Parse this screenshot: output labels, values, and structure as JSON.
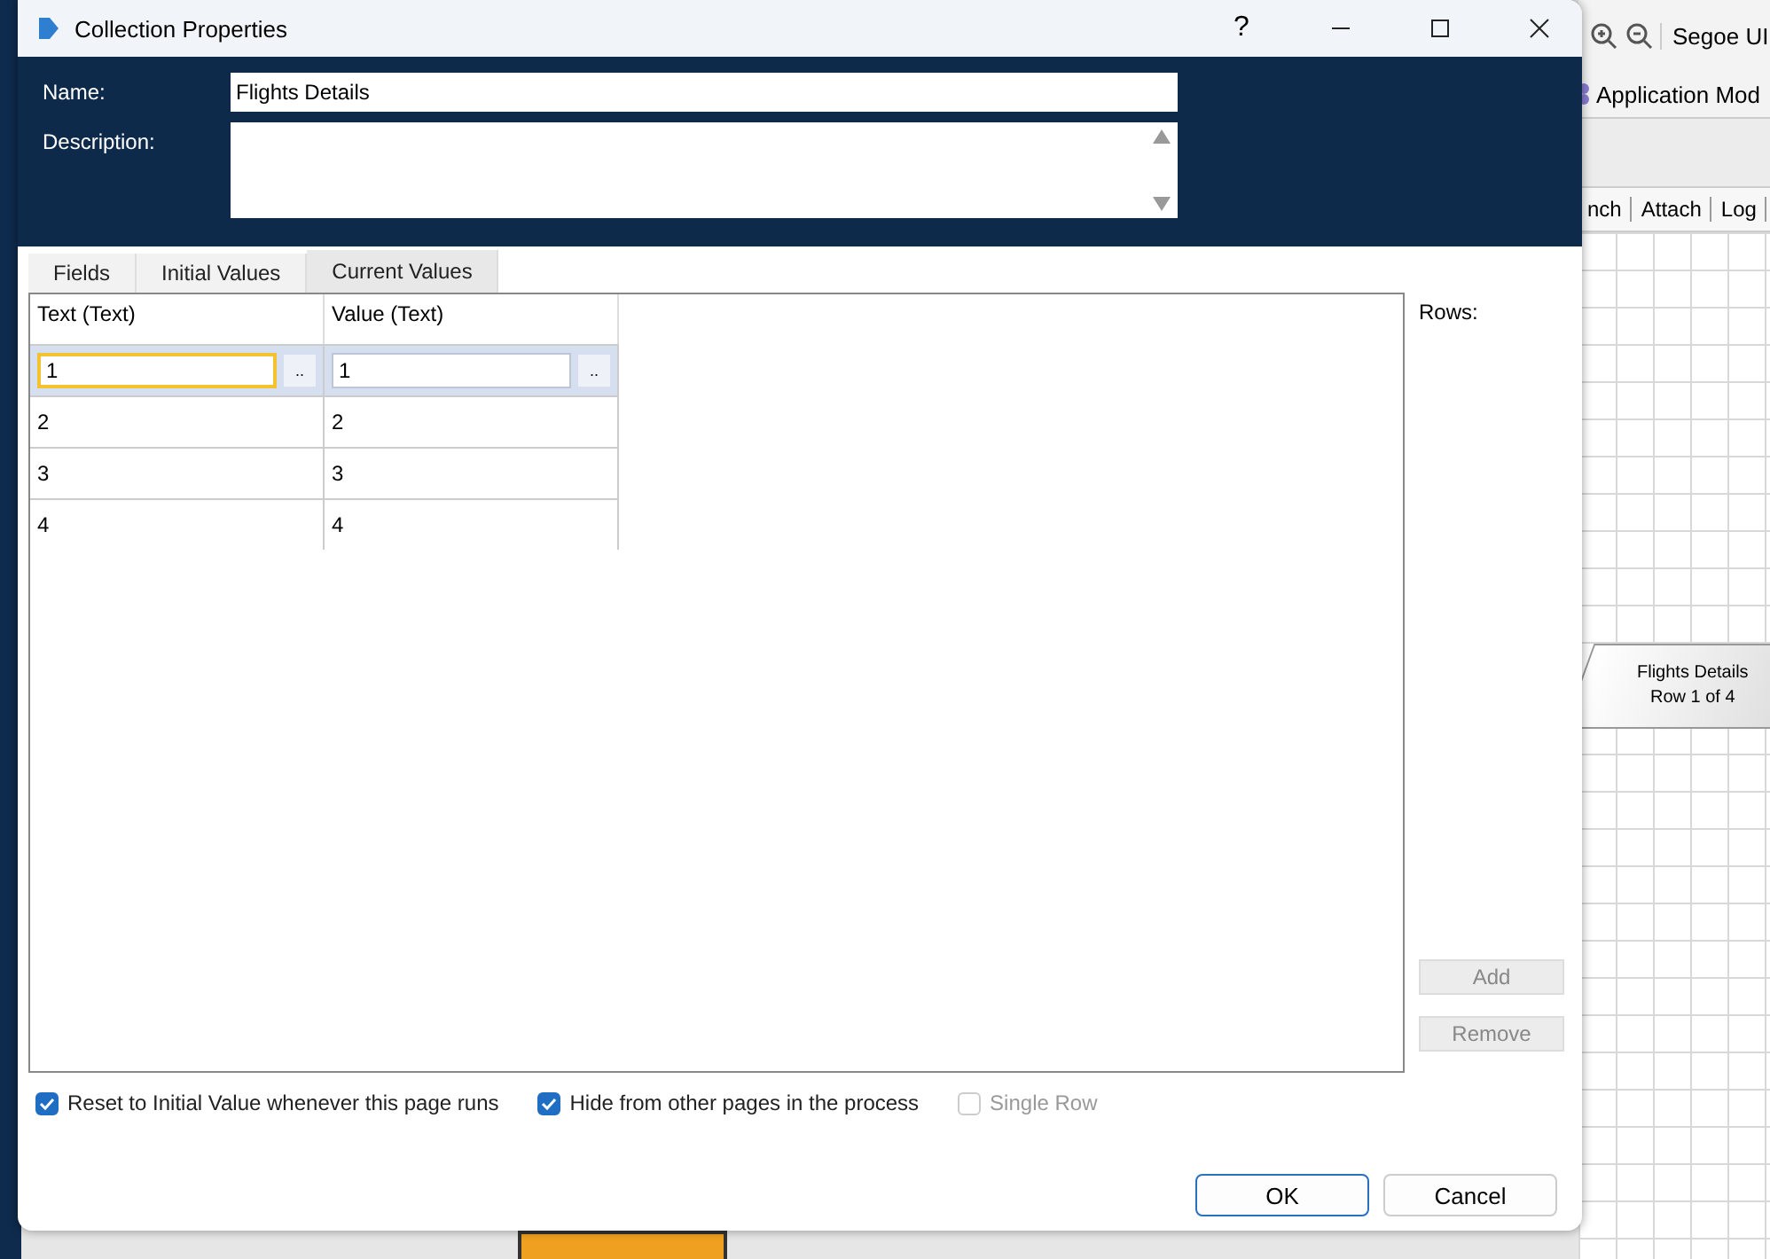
{
  "background_app": {
    "font_box": "Segoe UI",
    "menu_item": "Application Mod",
    "tabs": [
      "nch",
      "Attach",
      "Log"
    ],
    "canvas_shape": [
      "Flights Details",
      "Row 1 of 4"
    ]
  },
  "dialog": {
    "title": "Collection Properties",
    "help": "?",
    "header": {
      "name_label": "Name:",
      "name_value": "Flights Details",
      "description_label": "Description:"
    },
    "tabs": [
      {
        "label": "Fields",
        "selected": false
      },
      {
        "label": "Initial Values",
        "selected": false
      },
      {
        "label": "Current Values",
        "selected": true
      }
    ],
    "table": {
      "columns": [
        "Text (Text)",
        "Value (Text)"
      ],
      "rows": [
        {
          "cells": [
            "1",
            "1"
          ],
          "selected": true,
          "editing": true
        },
        {
          "cells": [
            "2",
            "2"
          ],
          "selected": false,
          "editing": false
        },
        {
          "cells": [
            "3",
            "3"
          ],
          "selected": false,
          "editing": false
        },
        {
          "cells": [
            "4",
            "4"
          ],
          "selected": false,
          "editing": false
        }
      ],
      "edit_button": ".."
    },
    "rows_label": "Rows:",
    "side_buttons": [
      {
        "label": "Add",
        "disabled": true
      },
      {
        "label": "Remove",
        "disabled": true
      }
    ],
    "checkboxes": [
      {
        "label": "Reset to Initial Value whenever this page runs",
        "checked": true,
        "disabled": false
      },
      {
        "label": "Hide from other pages in the process",
        "checked": true,
        "disabled": false
      },
      {
        "label": "Single Row",
        "checked": false,
        "disabled": true
      }
    ],
    "buttons": [
      {
        "label": "OK",
        "default": true
      },
      {
        "label": "Cancel",
        "default": false
      }
    ]
  }
}
